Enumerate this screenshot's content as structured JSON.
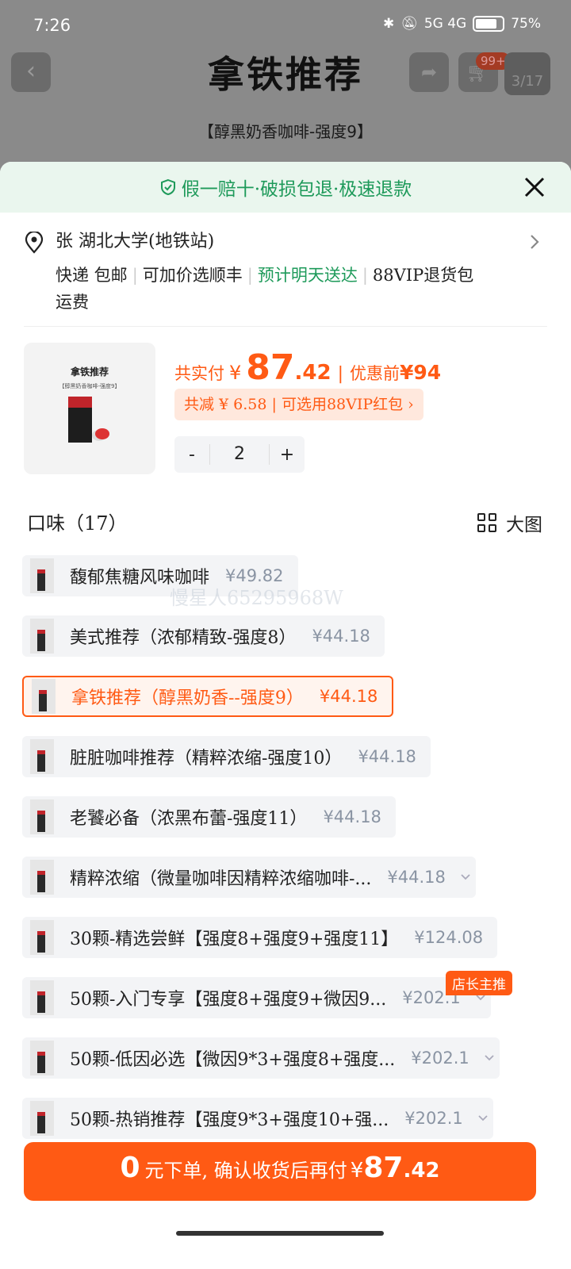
{
  "status_bar": {
    "time": "7:26",
    "network": "5G 4G",
    "battery": "75%"
  },
  "page": {
    "title": "拿铁推荐",
    "subtitle": "【醇黑奶香咖啡-强度9】",
    "cart_badge": "99+",
    "pager": "3/17"
  },
  "sheet": {
    "guarantee": "假一赔十·破损包退·极速退款",
    "address": {
      "name_addr": "张  湖北大学(地铁站)",
      "delivery": "快递 包邮",
      "option": "可加价选顺丰",
      "eta": "预计明天送达",
      "vip": "88VIP退货包",
      "vip2": "运费"
    },
    "product": {
      "thumb_title": "拿铁推荐",
      "thumb_sub": "【醇黑奶香咖啡-强度9】",
      "paid_label": "共实付",
      "currency": "¥",
      "price_int": "87",
      "price_dec": ".42",
      "pre_label": "优惠前",
      "pre_price": "¥94",
      "discount_text": "共减 ¥ 6.58 | 可选用88VIP红包 ›",
      "qty": "2",
      "minus": "-",
      "plus": "+"
    },
    "flavor_header": "口味（17）",
    "grid_label": "大图",
    "watermark": "慢星人65295968W",
    "options": [
      {
        "name": "馥郁焦糖风味咖啡",
        "price": "¥49.82"
      },
      {
        "name": "美式推荐（浓郁精致-强度8）",
        "price": "¥44.18"
      },
      {
        "name": "拿铁推荐（醇黑奶香--强度9）",
        "price": "¥44.18"
      },
      {
        "name": "脏脏咖啡推荐（精粹浓缩-强度10）",
        "price": "¥44.18"
      },
      {
        "name": "老饕必备（浓黑布蕾-强度11）",
        "price": "¥44.18"
      },
      {
        "name": "精粹浓缩（微量咖啡因精粹浓缩咖啡-...",
        "price": "¥44.18"
      },
      {
        "name": "30颗-精选尝鲜【强度8+强度9+强度11】",
        "price": "¥124.08"
      },
      {
        "name": "50颗-入门专享【强度8+强度9+微因9...",
        "price": "¥202.1"
      },
      {
        "name": "50颗-低因必选【微因9*3+强度8+强度...",
        "price": "¥202.1"
      },
      {
        "name": "50颗-热销推荐【强度9*3+强度10+强...",
        "price": "¥202.1"
      }
    ],
    "owner_badge": "店长主推",
    "order": {
      "zero": "0",
      "text": "元下单, 确认收货后再付",
      "cur": "¥",
      "int": "87",
      "dec": ".42"
    }
  },
  "colors": {
    "accent": "#ff5a14",
    "green": "#1e9a5a"
  }
}
